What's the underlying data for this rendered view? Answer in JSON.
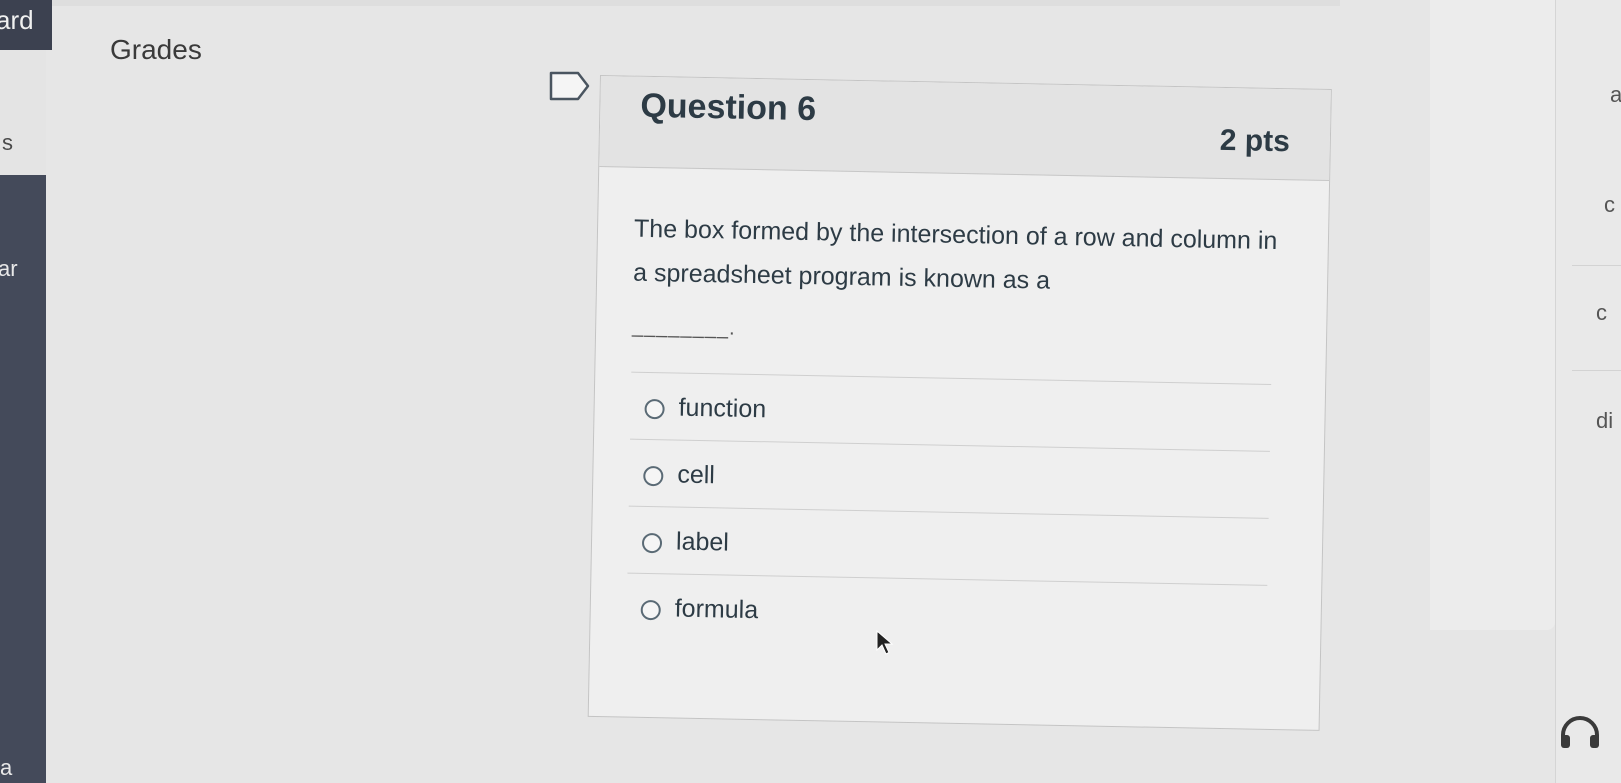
{
  "nav": {
    "left_fragment_top": "ard",
    "left_fragment_s": "s",
    "left_fragment_ar": "ar",
    "left_fragment_a": "a",
    "breadcrumb": "Grades"
  },
  "icons": {
    "flag": "flag-icon",
    "radio": "radio-empty",
    "cursor": "arrow-cursor-icon",
    "help": "headset-icon"
  },
  "question": {
    "title": "Question 6",
    "points": "2 pts",
    "text": "The box formed by the intersection of a row and column in a spreadsheet program is known as a",
    "blank": "________.",
    "answers": [
      {
        "label": "function"
      },
      {
        "label": "cell"
      },
      {
        "label": "label"
      },
      {
        "label": "formula"
      }
    ]
  },
  "right_fragments": [
    "a",
    "c",
    "c",
    "di"
  ],
  "colors": {
    "text": "#2d3b45",
    "sidebar": "#444a5a",
    "background": "#e6e6e6"
  }
}
